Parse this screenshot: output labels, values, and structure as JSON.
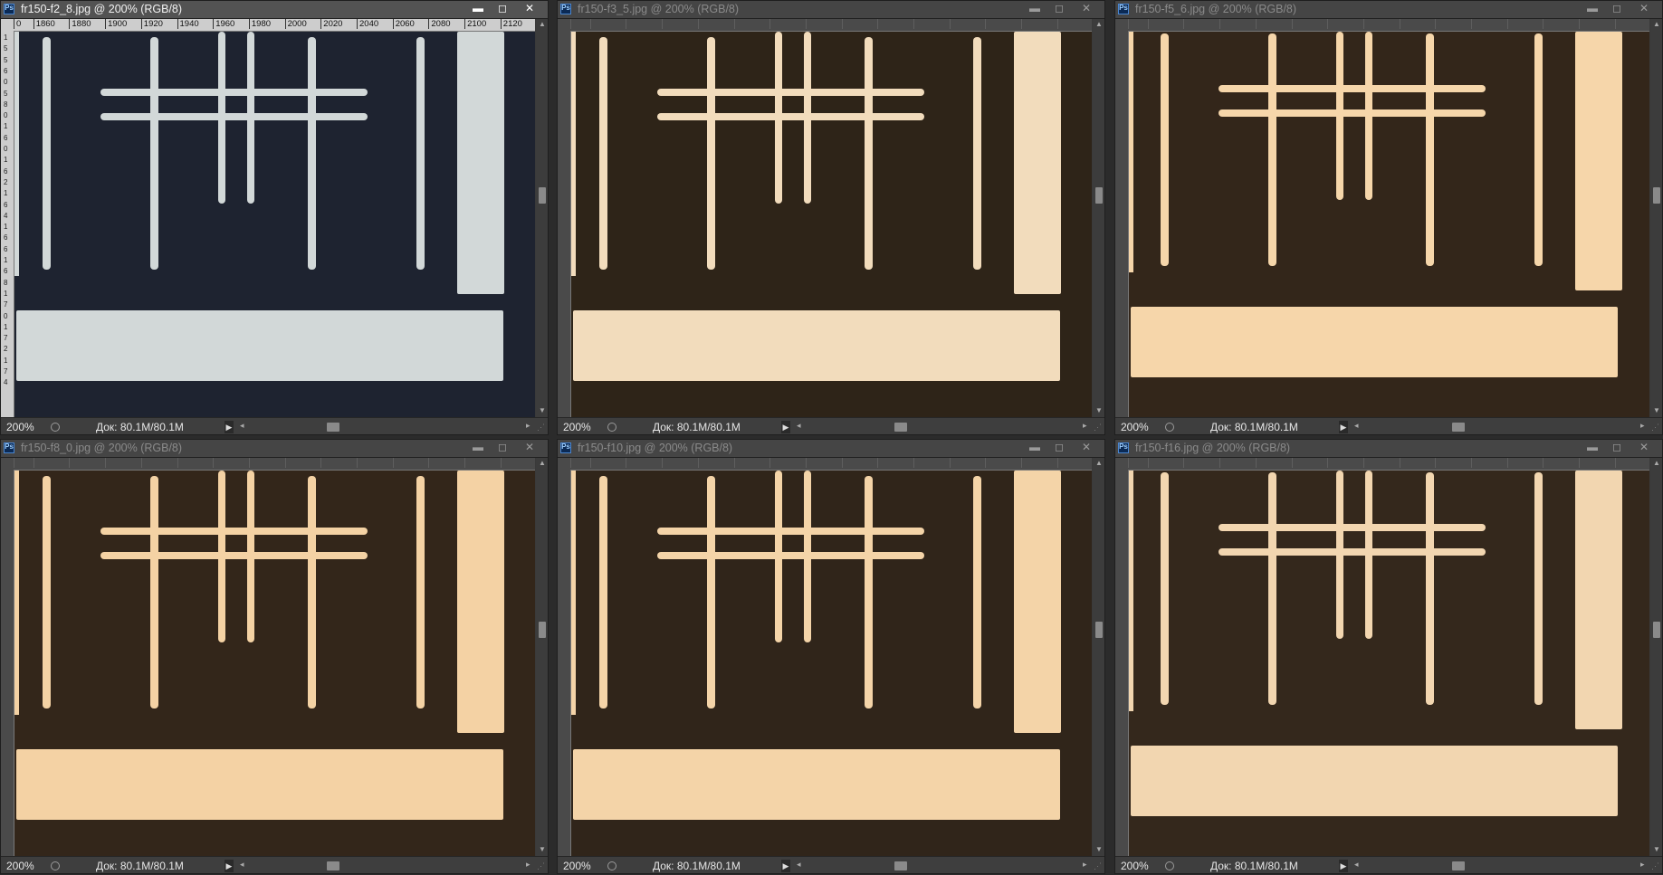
{
  "windows": [
    {
      "title": "fr150-f2_8.jpg @ 200% (RGB/8)",
      "zoom": "200%",
      "doc": "Док: 80.1M/80.1M",
      "active": true,
      "bg": "#1e2330",
      "fg": "#d2d8d8",
      "glow": "#e8ecec"
    },
    {
      "title": "fr150-f3_5.jpg @ 200% (RGB/8)",
      "zoom": "200%",
      "doc": "Док: 80.1M/80.1M",
      "active": false,
      "bg": "#2e2418",
      "fg": "#f2dcbc",
      "glow": "#ffe8c8"
    },
    {
      "title": "fr150-f5_6.jpg @ 200% (RGB/8)",
      "zoom": "200%",
      "doc": "Док: 80.1M/80.1M",
      "active": false,
      "bg": "#33261a",
      "fg": "#f6d6aa",
      "glow": "#ffe2b8"
    },
    {
      "title": "fr150-f8_0.jpg @ 200% (RGB/8)",
      "zoom": "200%",
      "doc": "Док: 80.1M/80.1M",
      "active": false,
      "bg": "#33261a",
      "fg": "#f4d2a4",
      "glow": "#ffdcb0"
    },
    {
      "title": "fr150-f10.jpg @ 200% (RGB/8)",
      "zoom": "200%",
      "doc": "Док: 80.1M/80.1M",
      "active": false,
      "bg": "#30251a",
      "fg": "#f4d4a8",
      "glow": "#ffdcb4"
    },
    {
      "title": "fr150-f16.jpg @ 200% (RGB/8)",
      "zoom": "200%",
      "doc": "Док: 80.1M/80.1M",
      "active": false,
      "bg": "#34281c",
      "fg": "#f2d6b0",
      "glow": "#fadfbc"
    }
  ],
  "window_buttons": {
    "minimize": "▬",
    "maximize": "◻",
    "close": "✕"
  },
  "ruler_labels": [
    "0",
    "1860",
    "1880",
    "1900",
    "1920",
    "1940",
    "1960",
    "1980",
    "2000",
    "2020",
    "2040",
    "2060",
    "2080",
    "2100",
    "2120"
  ],
  "vruler_labels": [
    "1",
    "5",
    "5",
    "6",
    "0",
    "5",
    "8",
    "0",
    "1",
    "6",
    "0",
    "1",
    "6",
    "2",
    "1",
    "6",
    "4",
    "1",
    "6",
    "6",
    "1",
    "6",
    "8",
    "1",
    "7",
    "0",
    "1",
    "7",
    "2",
    "1",
    "7",
    "4"
  ],
  "icons": {
    "app": "ps-icon",
    "nav": "navigator-icon",
    "play": "play-arrow-icon",
    "scroll_left": "arrow-left-icon",
    "scroll_right": "arrow-right-icon",
    "scroll_up": "arrow-up-icon",
    "scroll_down": "arrow-down-icon"
  }
}
